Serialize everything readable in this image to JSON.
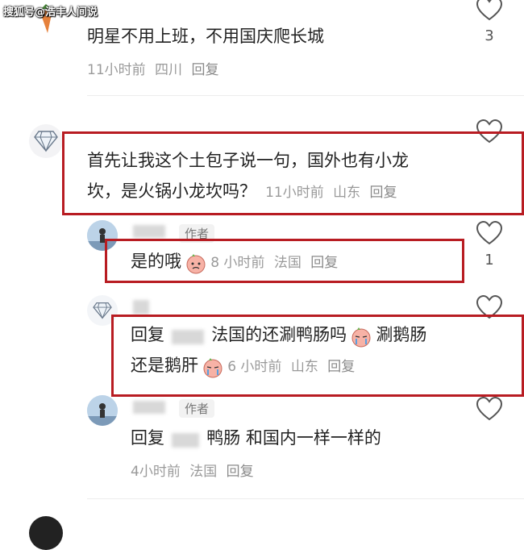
{
  "watermark": "搜狐号@浩丰人间说",
  "comments": [
    {
      "text": "明星不用上班，不用国庆爬长城",
      "time": "11小时前",
      "location": "四川",
      "reply": "回复",
      "likes": "3"
    },
    {
      "text_line1": "首先让我这个土包子说一句，国外也有小龙",
      "text_line2": "坎，是火锅小龙坎吗？",
      "time": "11小时前",
      "location": "山东",
      "reply": "回复",
      "likes": ""
    }
  ],
  "replies": [
    {
      "author_tag": "作者",
      "text": "是的哦",
      "time": "8 小时前",
      "location": "法国",
      "reply": "回复",
      "likes": "1"
    },
    {
      "reply_prefix": "回复",
      "text_part1": "法国的还涮鸭肠吗",
      "text_part2": "涮鹅肠",
      "text_line2": "还是鹅肝",
      "time": "6 小时前",
      "location": "山东",
      "reply": "回复"
    },
    {
      "author_tag": "作者",
      "reply_prefix": "回复",
      "text": "鸭肠 和国内一样一样的",
      "time": "4小时前",
      "location": "法国",
      "reply": "回复"
    }
  ],
  "colors": {
    "highlight_box": "#b81c22",
    "meta_text": "#9a9a9a"
  },
  "icons": [
    "heart-outline-icon",
    "diamond-icon",
    "carrot-icon",
    "crying-face-emoji"
  ]
}
